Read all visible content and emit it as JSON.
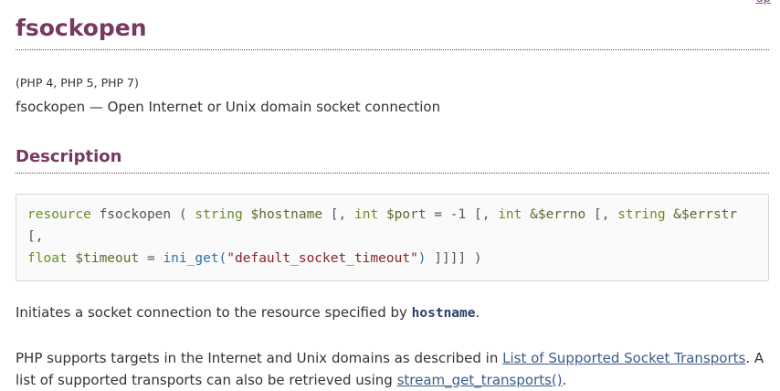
{
  "top_link": "up",
  "page_title": "fsockopen",
  "versions": "(PHP 4, PHP 5, PHP 7)",
  "refpurpose": "fsockopen — Open Internet or Unix domain socket connection",
  "description_heading": "Description",
  "synopsis": {
    "return_type": "resource",
    "function_name": "fsockopen",
    "open_paren": "(",
    "p1_type": "string",
    "p1_var": "$hostname",
    "p2_prefix": "[,",
    "p2_type": "int",
    "p2_var": "$port",
    "p2_default": "= -1",
    "p3_prefix": "[,",
    "p3_type": "int",
    "p3_var": "&$errno",
    "p4_prefix": "[,",
    "p4_type": "string",
    "p4_var": "&$errstr",
    "p5_prefix": "[,",
    "p5_type": "float",
    "p5_var": "$timeout",
    "p5_eq": "=",
    "p5_default_fn": "ini_get(",
    "p5_default_str": "\"default_socket_timeout\"",
    "p5_default_close": ")",
    "closing": "]]]] )"
  },
  "para1": {
    "text_before": "Initiates a socket connection to the resource specified by ",
    "param": "hostname",
    "text_after": "."
  },
  "para2": {
    "text_before": "PHP supports targets in the Internet and Unix domains as described in ",
    "link1": "List of Supported Socket Transports",
    "text_middle": ". A list of supported transports can also be retrieved using ",
    "link2": "stream_get_transports()",
    "text_after": "."
  }
}
